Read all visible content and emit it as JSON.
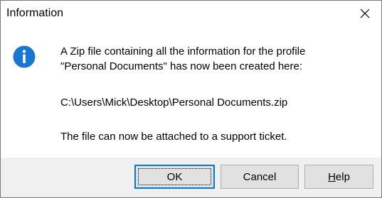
{
  "dialog": {
    "title": "Information",
    "close_icon": "close-icon",
    "icon": "info-icon",
    "icon_color": "#1976d2",
    "message": {
      "line1": "A Zip file containing all the information for the profile",
      "line2": "\"Personal Documents\" has now been created here:",
      "path": "C:\\Users\\Mick\\Desktop\\Personal Documents.zip",
      "note": "The file can now be attached to a support ticket."
    },
    "buttons": {
      "ok": "OK",
      "cancel": "Cancel",
      "help_prefix": "H",
      "help_rest": "elp"
    }
  }
}
